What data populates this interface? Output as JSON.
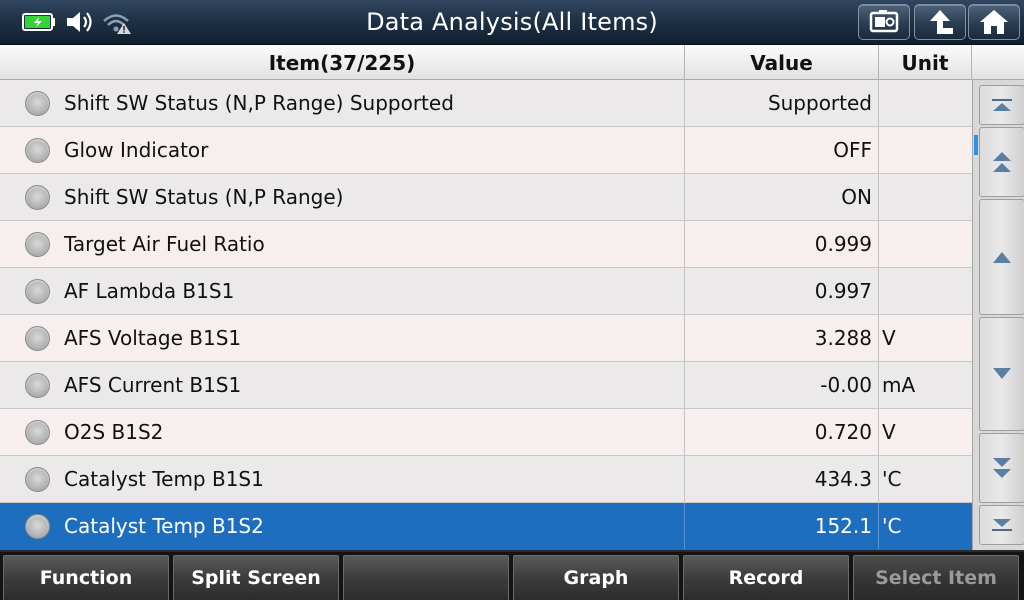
{
  "header": {
    "title": "Data Analysis(All Items)",
    "status_icons": [
      "battery-charging-icon",
      "speaker-icon",
      "wifi-warning-icon"
    ],
    "buttons": [
      "screenshot-icon",
      "back-arrow-icon",
      "home-icon"
    ]
  },
  "table": {
    "columns": {
      "item": "Item(37/225)",
      "value": "Value",
      "unit": "Unit"
    },
    "rows": [
      {
        "label": "Shift SW Status (N,P Range) Supported",
        "value": "Supported",
        "unit": ""
      },
      {
        "label": "Glow Indicator",
        "value": "OFF",
        "unit": ""
      },
      {
        "label": "Shift SW Status (N,P Range)",
        "value": "ON",
        "unit": ""
      },
      {
        "label": "Target Air Fuel Ratio",
        "value": "0.999",
        "unit": ""
      },
      {
        "label": "AF Lambda B1S1",
        "value": "0.997",
        "unit": ""
      },
      {
        "label": "AFS Voltage B1S1",
        "value": "3.288",
        "unit": "V"
      },
      {
        "label": "AFS Current B1S1",
        "value": "-0.00",
        "unit": "mA"
      },
      {
        "label": "O2S B1S2",
        "value": "0.720",
        "unit": "V"
      },
      {
        "label": "Catalyst Temp B1S1",
        "value": "434.3",
        "unit": "'C"
      },
      {
        "label": "Catalyst Temp B1S2",
        "value": "152.1",
        "unit": "'C"
      }
    ],
    "selected_index": 9
  },
  "scrollbar": {
    "buttons": [
      "scroll-top-icon",
      "page-up-icon",
      "line-up-icon",
      "line-down-icon",
      "page-down-icon",
      "scroll-bottom-icon"
    ]
  },
  "toolbar": {
    "function_label": "Function",
    "split_screen_label": "Split Screen",
    "empty_label": "",
    "graph_label": "Graph",
    "record_label": "Record",
    "select_item_label": "Select Item"
  },
  "colors": {
    "selected_row": "#1e6ec0",
    "battery_green": "#37d237",
    "scroll_indicator": "#2c8fe8"
  }
}
